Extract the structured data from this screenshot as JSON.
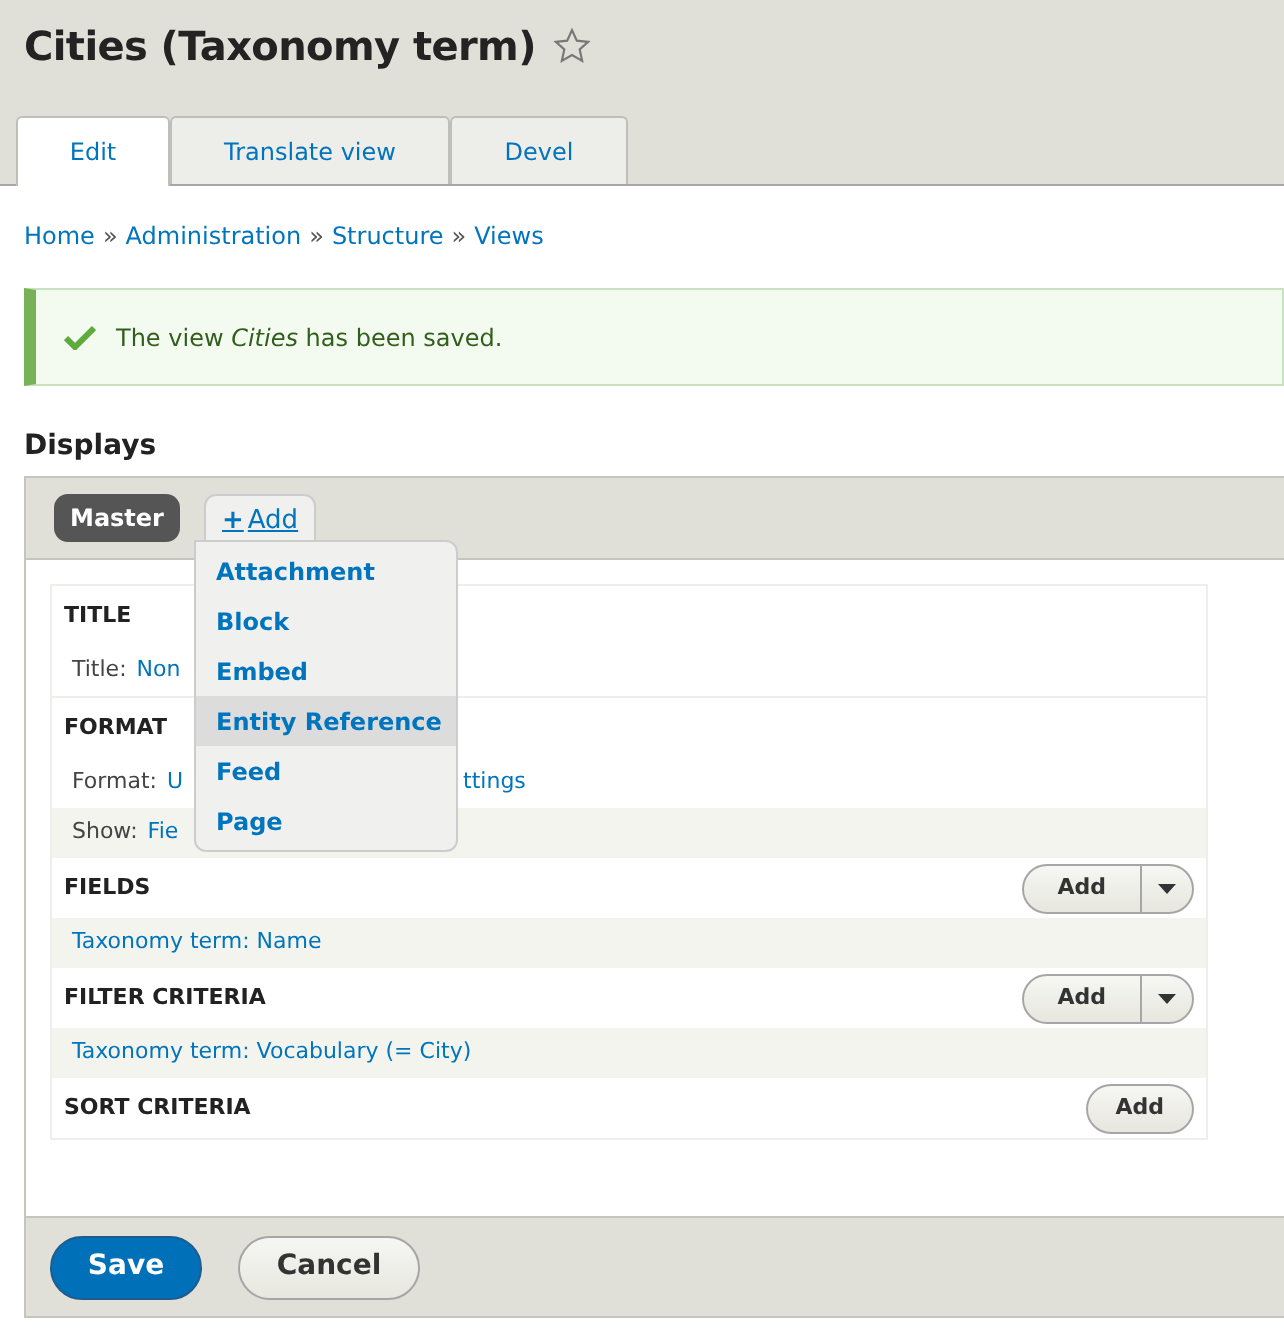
{
  "page_title": "Cities (Taxonomy term)",
  "tabs": [
    {
      "label": "Edit",
      "selected": true
    },
    {
      "label": "Translate view",
      "selected": false
    },
    {
      "label": "Devel",
      "selected": false
    }
  ],
  "breadcrumb": [
    "Home",
    "Administration",
    "Structure",
    "Views"
  ],
  "breadcrumb_separator": "»",
  "message": {
    "text": "The view *Cities* has been saved."
  },
  "displays": {
    "heading": "Displays",
    "tabs": [
      {
        "label": "Master",
        "selected": true
      }
    ],
    "add_link": {
      "icon": "+",
      "label": "Add"
    },
    "add_menu": [
      {
        "label": "Attachment",
        "selected": false
      },
      {
        "label": "Block",
        "selected": false
      },
      {
        "label": "Embed",
        "selected": false
      },
      {
        "label": "Entity Reference",
        "selected": true
      },
      {
        "label": "Feed",
        "selected": false
      },
      {
        "label": "Page",
        "selected": false
      }
    ]
  },
  "sections": [
    {
      "heading": "TITLE",
      "kind": "none",
      "items": [
        {
          "label": "Title:",
          "value_parts": [
            "Non"
          ],
          "shaded": false
        }
      ]
    },
    {
      "heading": "FORMAT",
      "kind": "none",
      "items": [
        {
          "label": "Format:",
          "value_parts": [
            "U",
            "ttings"
          ],
          "shaded": false
        },
        {
          "label": "Show:",
          "value_parts": [
            "Fie"
          ],
          "shaded": true
        }
      ]
    },
    {
      "heading": "FIELDS",
      "kind": "split",
      "button_label": "Add",
      "items": [
        {
          "value_parts": [
            "Taxonomy term: Name"
          ],
          "shaded": true
        }
      ]
    },
    {
      "heading": "FILTER CRITERIA",
      "kind": "split",
      "button_label": "Add",
      "items": [
        {
          "value_parts": [
            "Taxonomy term: Vocabulary (= City)"
          ],
          "shaded": true
        }
      ]
    },
    {
      "heading": "SORT CRITERIA",
      "kind": "plain",
      "button_label": "Add"
    }
  ],
  "actions": [
    {
      "label": "Save",
      "kind": "primary"
    },
    {
      "label": "Cancel",
      "kind": "secondary"
    }
  ]
}
